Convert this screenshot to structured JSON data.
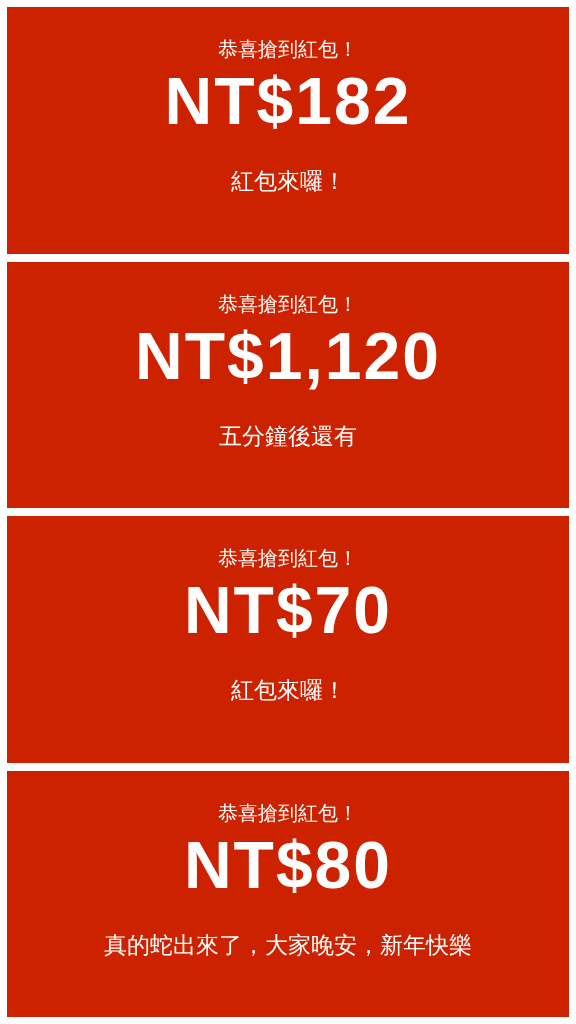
{
  "cards": [
    {
      "title": "恭喜搶到紅包！",
      "amount": "NT$182",
      "message": "紅包來囉！"
    },
    {
      "title": "恭喜搶到紅包！",
      "amount": "NT$1,120",
      "message": "五分鐘後還有"
    },
    {
      "title": "恭喜搶到紅包！",
      "amount": "NT$70",
      "message": "紅包來囉！"
    },
    {
      "title": "恭喜搶到紅包！",
      "amount": "NT$80",
      "message": "真的蛇出來了，大家晚安，新年快樂"
    }
  ]
}
